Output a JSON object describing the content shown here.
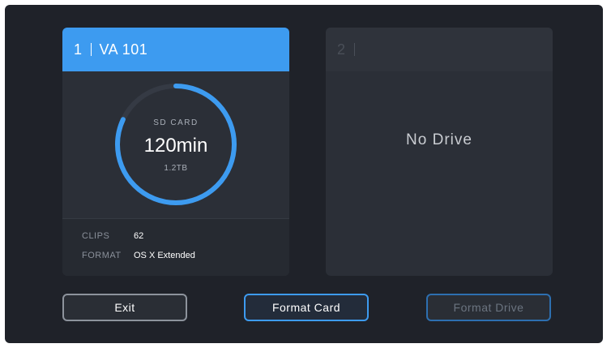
{
  "slot1": {
    "number": "1",
    "name": "VA 101",
    "media_type": "SD CARD",
    "remaining_time": "120min",
    "capacity": "1.2TB",
    "fill_fraction": 0.82,
    "clips_label": "CLIPS",
    "clips_value": "62",
    "format_label": "FORMAT",
    "format_value": "OS X Extended"
  },
  "slot2": {
    "number": "2",
    "status": "No Drive"
  },
  "buttons": {
    "exit": "Exit",
    "format_card": "Format Card",
    "format_drive": "Format Drive"
  },
  "colors": {
    "accent": "#3d9bf0",
    "ring_track": "#353a44",
    "panel": "#2b2f37",
    "background": "#1f2229"
  }
}
